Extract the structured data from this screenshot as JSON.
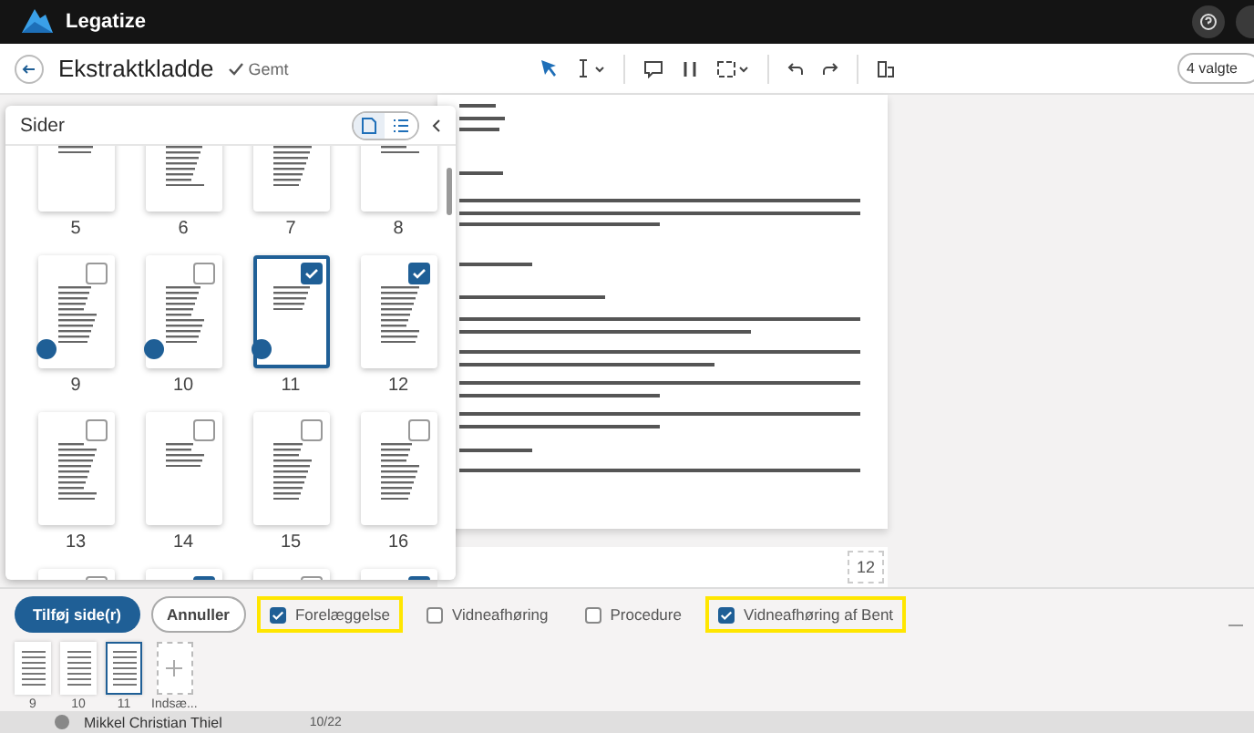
{
  "app": {
    "name": "Legatize"
  },
  "toolbar": {
    "title": "Ekstraktkladde",
    "save_status": "Gemt",
    "selection": "4 valgte"
  },
  "pages_panel": {
    "title": "Sider",
    "top_row": [
      {
        "number": "5"
      },
      {
        "number": "6"
      },
      {
        "number": "7"
      },
      {
        "number": "8"
      }
    ],
    "pages": [
      {
        "number": "9",
        "checked": false,
        "selected": false,
        "in_extract": true
      },
      {
        "number": "10",
        "checked": false,
        "selected": false,
        "in_extract": true
      },
      {
        "number": "11",
        "checked": true,
        "selected": true,
        "in_extract": true
      },
      {
        "number": "12",
        "checked": true,
        "selected": false,
        "in_extract": false
      },
      {
        "number": "13",
        "checked": false,
        "selected": false,
        "in_extract": false
      },
      {
        "number": "14",
        "checked": false,
        "selected": false,
        "in_extract": false
      },
      {
        "number": "15",
        "checked": false,
        "selected": false,
        "in_extract": false
      },
      {
        "number": "16",
        "checked": false,
        "selected": false,
        "in_extract": false
      }
    ],
    "bottom_row": [
      {
        "checked": false
      },
      {
        "checked": true
      },
      {
        "checked": false
      },
      {
        "checked": true
      }
    ]
  },
  "document": {
    "page_number": "12"
  },
  "extract_panel": {
    "add_button": "Tilføj side(r)",
    "cancel_button": "Annuller",
    "categories": [
      {
        "label": "Forelæggelse",
        "checked": true,
        "highlighted": true
      },
      {
        "label": "Vidneafhøring",
        "checked": false,
        "highlighted": false
      },
      {
        "label": "Procedure",
        "checked": false,
        "highlighted": false
      },
      {
        "label": "Vidneafhøring af Bent",
        "checked": true,
        "highlighted": true
      }
    ],
    "thumbnails": [
      {
        "number": "9",
        "selected": false
      },
      {
        "number": "10",
        "selected": false
      },
      {
        "number": "11",
        "selected": true
      }
    ],
    "insert_label": "Indsæ..."
  },
  "footer": {
    "user": "Mikkel Christian Thiel",
    "date": "10/22"
  }
}
